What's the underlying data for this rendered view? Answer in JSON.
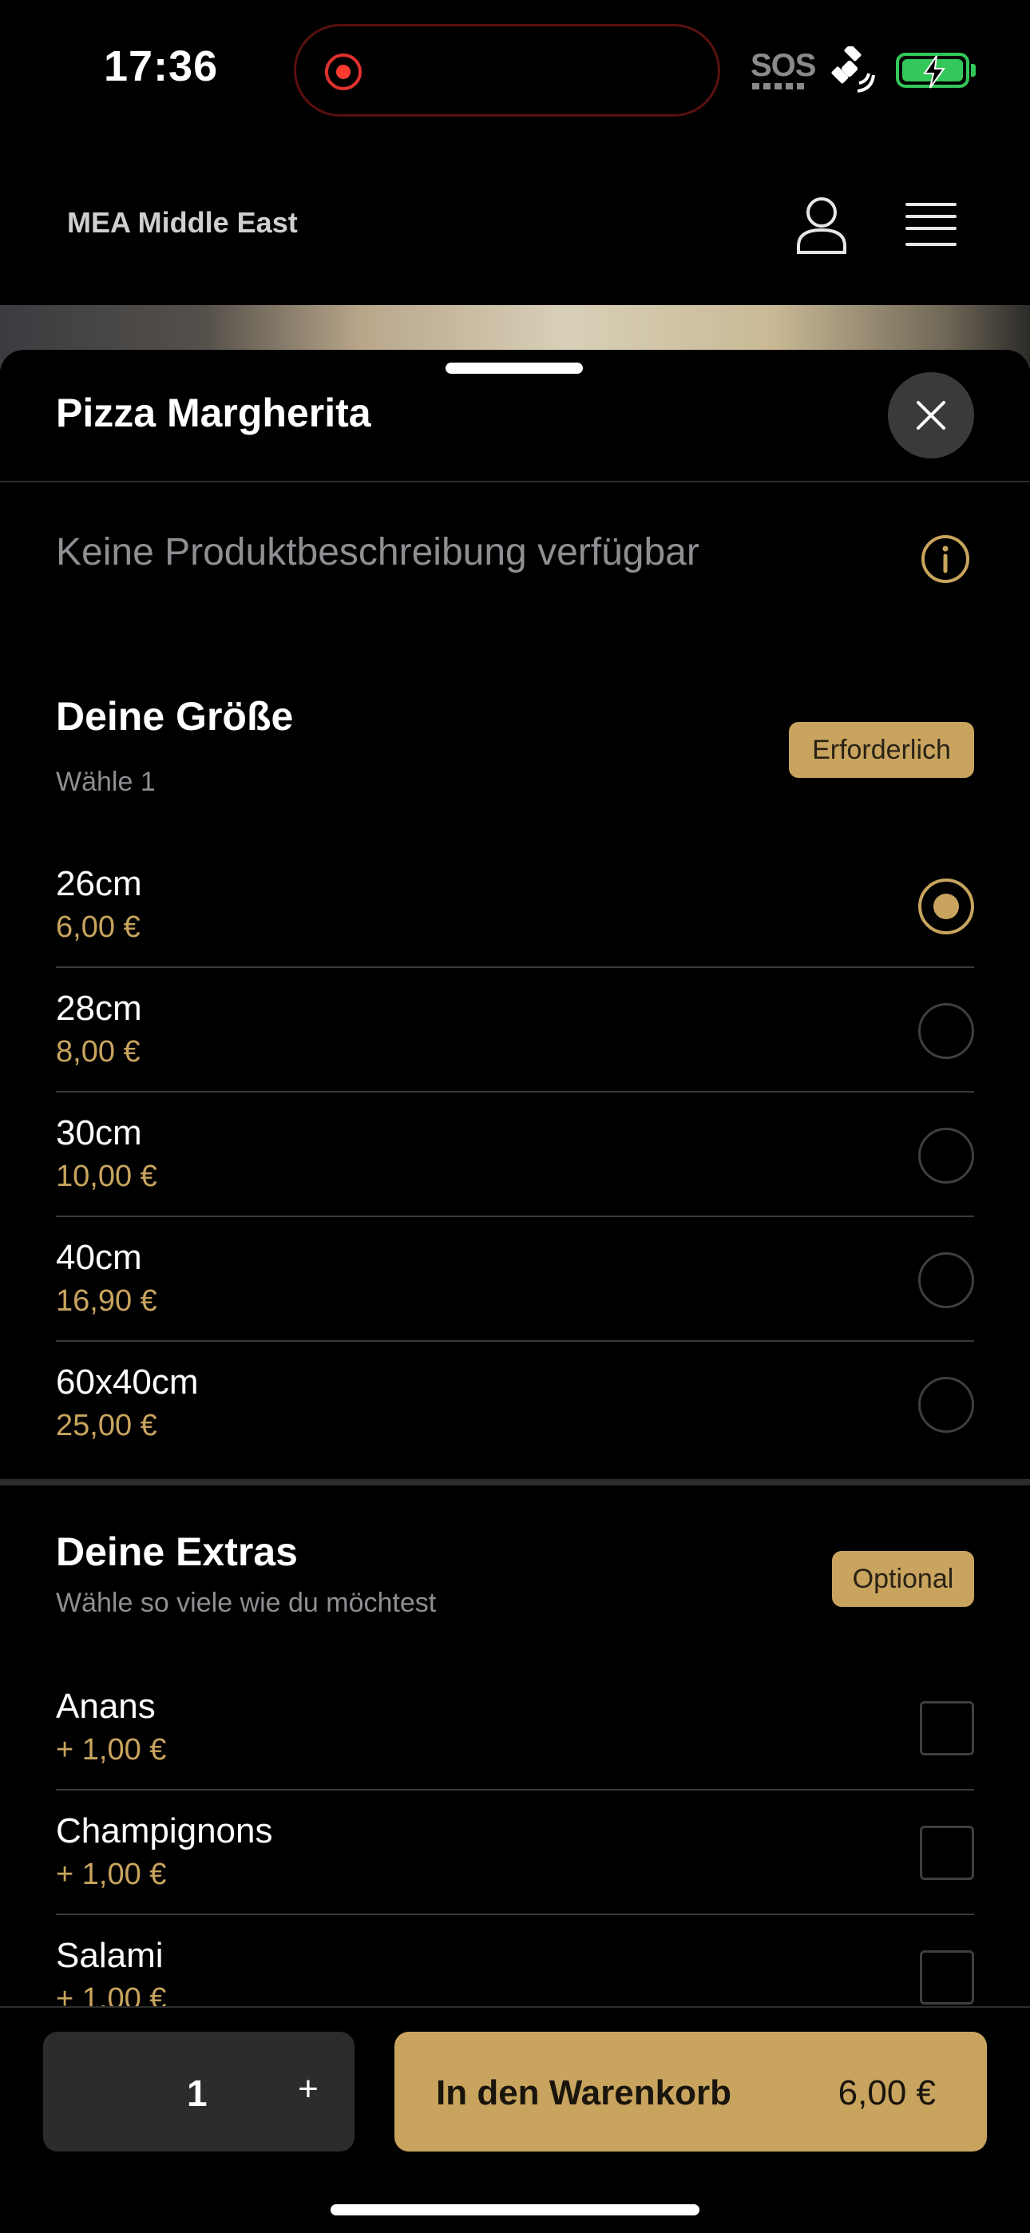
{
  "status_bar": {
    "time": "17:36",
    "sos": "SOS",
    "icons": [
      "screen-recording-icon",
      "satellite-icon",
      "battery-charging-icon"
    ]
  },
  "header": {
    "brand": "MEA Middle East",
    "icons": [
      "user-icon",
      "menu-icon"
    ]
  },
  "sheet": {
    "title": "Pizza Margherita",
    "description": "Keine Produktbeschreibung verfügbar"
  },
  "size_group": {
    "title": "Deine Größe",
    "subtitle": "Wähle 1",
    "badge": "Erforderlich",
    "options": [
      {
        "name": "26cm",
        "price": "6,00 €",
        "selected": true
      },
      {
        "name": "28cm",
        "price": "8,00 €",
        "selected": false
      },
      {
        "name": "30cm",
        "price": "10,00 €",
        "selected": false
      },
      {
        "name": "40cm",
        "price": "16,90 €",
        "selected": false
      },
      {
        "name": "60x40cm",
        "price": "25,00 €",
        "selected": false
      }
    ]
  },
  "extras_group": {
    "title": "Deine Extras",
    "subtitle": "Wähle so viele wie du möchtest",
    "badge": "Optional",
    "options": [
      {
        "name": "Anans",
        "price": "+ 1,00 €",
        "checked": false
      },
      {
        "name": "Champignons",
        "price": "+ 1,00 €",
        "checked": false
      },
      {
        "name": "Salami",
        "price": "+ 1,00 €",
        "checked": false
      }
    ]
  },
  "footer": {
    "quantity": "1",
    "plus": "+",
    "cart_label": "In den Warenkorb",
    "cart_price": "6,00 €"
  },
  "colors": {
    "accent": "#c8a45e",
    "background": "#000000",
    "muted_text": "#8e8e93",
    "divider": "#3a3a3c"
  }
}
